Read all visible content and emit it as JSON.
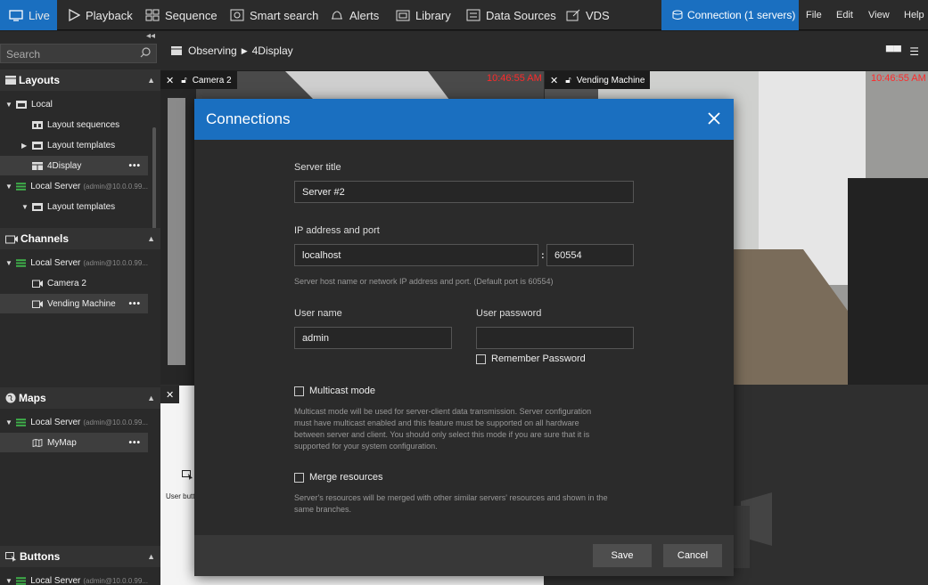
{
  "nav": {
    "live": "Live",
    "playback": "Playback",
    "sequence": "Sequence",
    "smart_search": "Smart search",
    "alerts": "Alerts",
    "library": "Library",
    "data_sources": "Data Sources",
    "vds": "VDS",
    "connection": "Connection (1 servers)",
    "file": "File",
    "edit": "Edit",
    "view": "View",
    "help": "Help"
  },
  "sidebar": {
    "search_placeholder": "Search",
    "layouts": {
      "title": "Layouts",
      "local": "Local",
      "layout_sequences": "Layout sequences",
      "layout_templates": "Layout templates",
      "display": "4Display",
      "local_server": "Local Server",
      "server_sub": "(admin@10.0.0.99...",
      "server_layout_templates": "Layout templates"
    },
    "channels": {
      "title": "Channels",
      "local_server": "Local Server",
      "server_sub": "(admin@10.0.0.99...",
      "camera2": "Camera 2",
      "vending": "Vending Machine"
    },
    "maps": {
      "title": "Maps",
      "local_server": "Local Server",
      "server_sub": "(admin@10.0.0.99...",
      "mymap": "MyMap"
    },
    "buttons": {
      "title": "Buttons",
      "local_server": "Local Server",
      "server_sub": "(admin@10.0.0.99..."
    },
    "more_dots": "•••"
  },
  "breadcrumb": {
    "root": "Observing",
    "current": "4Display"
  },
  "cameras": {
    "cam1": {
      "label": "Camera 2",
      "time": "10:46:55 AM"
    },
    "cam2": {
      "label": "Vending Machine",
      "time": "10:46:55 AM"
    },
    "cam3_text": "User butt"
  },
  "dialog": {
    "title": "Connections",
    "server_title_label": "Server title",
    "server_title_value": "Server #2",
    "ip_label": "IP address and port",
    "ip_value": "localhost",
    "port_sep": ":",
    "port_value": "60554",
    "ip_hint": "Server host name or network IP address and port. (Default port is 60554)",
    "user_label": "User name",
    "user_value": "admin",
    "password_label": "User password",
    "password_value": "",
    "remember": "Remember Password",
    "multicast": "Multicast mode",
    "multicast_hint_1": "Multicast mode will be used for server-client data transmission. Server configuration",
    "multicast_hint_2": "must have multicast enabled and this feature must be supported on all hardware",
    "multicast_hint_3": "between server and client. You should only select this mode if you are sure that it is",
    "multicast_hint_4": "supported for your system configuration.",
    "merge": "Merge resources",
    "merge_hint_1": "Server's resources will be merged with other similar servers' resources and shown in the",
    "merge_hint_2": "same branches.",
    "save": "Save",
    "cancel": "Cancel"
  },
  "colors": {
    "accent": "#1a6fc0",
    "timestamp": "#ff2a2a",
    "server_green": "#3fb24b"
  }
}
